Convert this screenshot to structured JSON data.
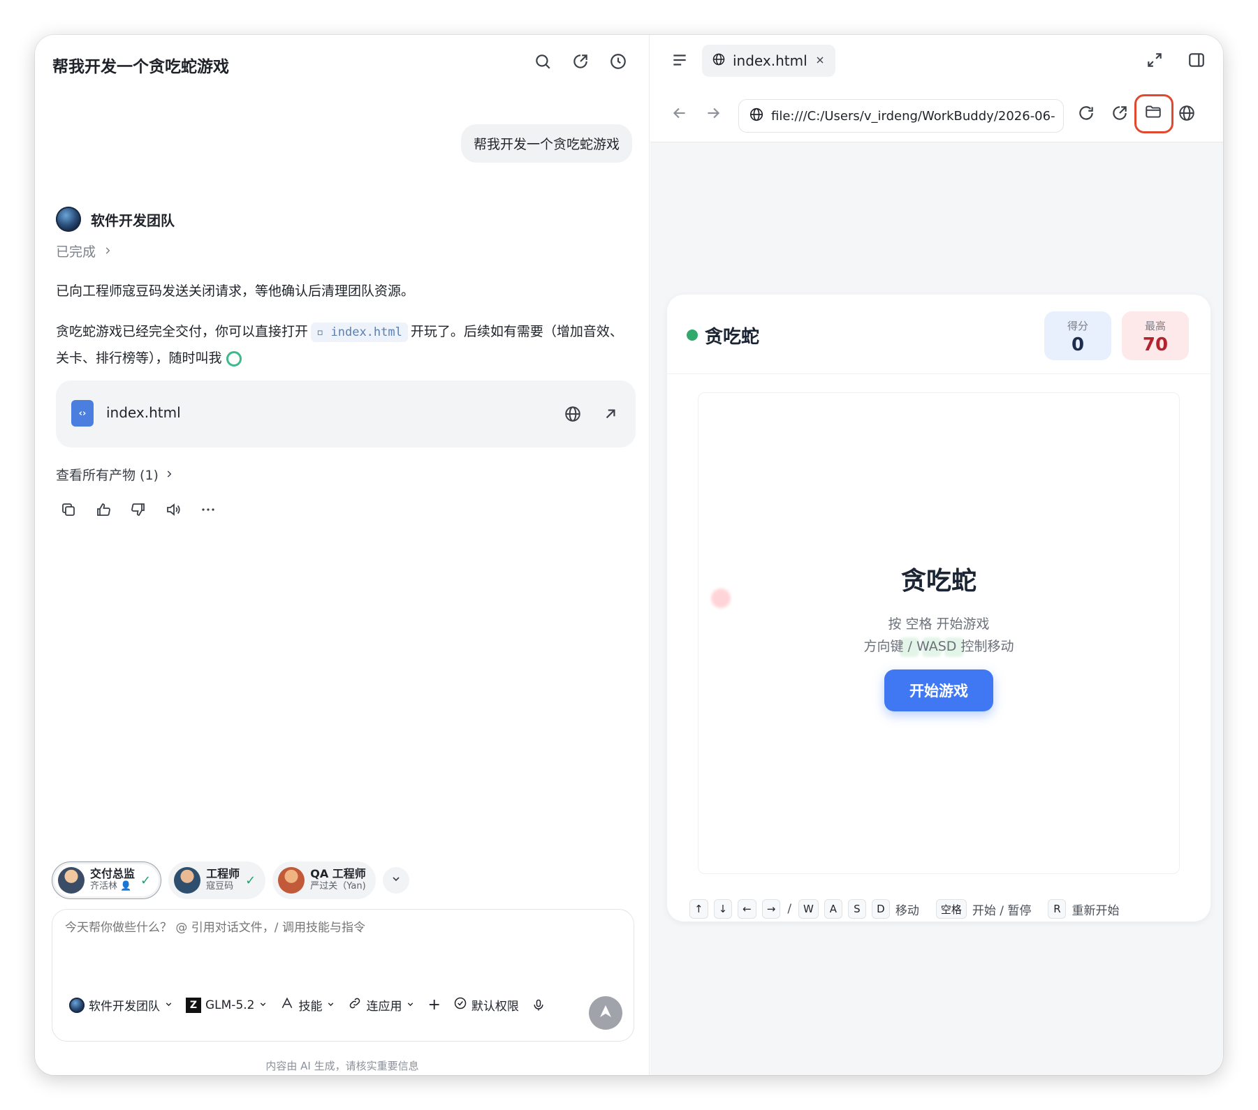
{
  "chat": {
    "title": "帮我开发一个贪吃蛇游戏",
    "user_message": "帮我开发一个贪吃蛇游戏",
    "agent_name": "软件开发团队",
    "status": "已完成",
    "para1": "已向工程师寇豆码发送关闭请求，等他确认后清理团队资源。",
    "para2_before": "贪吃蛇游戏已经完全交付，你可以直接打开",
    "para2_chip": "index.html",
    "para2_after": "开玩了。后续如有需要（增加音效、关卡、排行榜等），随时叫我",
    "file_card_name": "index.html",
    "artifacts_link": "查看所有产物 (1)"
  },
  "chips": [
    {
      "title": "交付总监",
      "sub": "齐活林"
    },
    {
      "title": "工程师",
      "sub": "寇豆码"
    },
    {
      "title": "QA 工程师",
      "sub": "严过关（Yan)"
    }
  ],
  "input": {
    "placeholder": "今天帮你做些什么？ @ 引用对话文件，/ 调用技能与指令",
    "team": "软件开发团队",
    "model": "GLM-5.2",
    "skills": "技能",
    "connect": "连应用",
    "permission": "默认权限"
  },
  "footer_note": "内容由 AI 生成，请核实重要信息",
  "browser": {
    "tab_title": "index.html",
    "url": "file:///C:/Users/v_irdeng/WorkBuddy/2026-06-"
  },
  "game": {
    "title": "贪吃蛇",
    "score_label": "得分",
    "score": "0",
    "best_label": "最高",
    "best": "70",
    "overlay_title": "贪吃蛇",
    "overlay_line1": "按 空格 开始游戏",
    "overlay_line2": "方向键 / WASD 控制移动",
    "start_button": "开始游戏",
    "controls": {
      "up": "↑",
      "down": "↓",
      "left": "←",
      "right": "→",
      "slash": "/",
      "w": "W",
      "a": "A",
      "s": "S",
      "d": "D",
      "move": "移动",
      "space": "空格",
      "start_pause": "开始 / 暂停",
      "r": "R",
      "restart": "重新开始"
    }
  },
  "colors": {
    "accent_blue": "#3f78f2",
    "highlight_red": "#e0492f",
    "status_green": "#2faa6b"
  }
}
